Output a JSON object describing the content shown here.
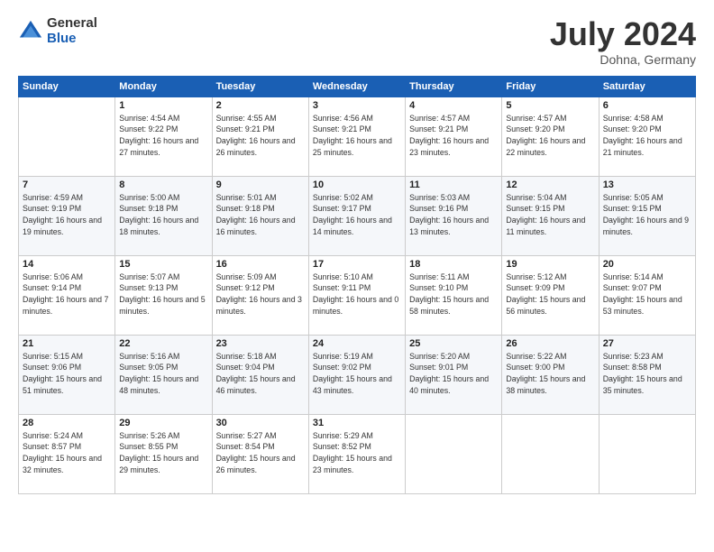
{
  "header": {
    "logo_general": "General",
    "logo_blue": "Blue",
    "month_title": "July 2024",
    "subtitle": "Dohna, Germany"
  },
  "calendar": {
    "days_of_week": [
      "Sunday",
      "Monday",
      "Tuesday",
      "Wednesday",
      "Thursday",
      "Friday",
      "Saturday"
    ],
    "weeks": [
      [
        {
          "day": "",
          "sunrise": "",
          "sunset": "",
          "daylight": ""
        },
        {
          "day": "1",
          "sunrise": "Sunrise: 4:54 AM",
          "sunset": "Sunset: 9:22 PM",
          "daylight": "Daylight: 16 hours and 27 minutes."
        },
        {
          "day": "2",
          "sunrise": "Sunrise: 4:55 AM",
          "sunset": "Sunset: 9:21 PM",
          "daylight": "Daylight: 16 hours and 26 minutes."
        },
        {
          "day": "3",
          "sunrise": "Sunrise: 4:56 AM",
          "sunset": "Sunset: 9:21 PM",
          "daylight": "Daylight: 16 hours and 25 minutes."
        },
        {
          "day": "4",
          "sunrise": "Sunrise: 4:57 AM",
          "sunset": "Sunset: 9:21 PM",
          "daylight": "Daylight: 16 hours and 23 minutes."
        },
        {
          "day": "5",
          "sunrise": "Sunrise: 4:57 AM",
          "sunset": "Sunset: 9:20 PM",
          "daylight": "Daylight: 16 hours and 22 minutes."
        },
        {
          "day": "6",
          "sunrise": "Sunrise: 4:58 AM",
          "sunset": "Sunset: 9:20 PM",
          "daylight": "Daylight: 16 hours and 21 minutes."
        }
      ],
      [
        {
          "day": "7",
          "sunrise": "Sunrise: 4:59 AM",
          "sunset": "Sunset: 9:19 PM",
          "daylight": "Daylight: 16 hours and 19 minutes."
        },
        {
          "day": "8",
          "sunrise": "Sunrise: 5:00 AM",
          "sunset": "Sunset: 9:18 PM",
          "daylight": "Daylight: 16 hours and 18 minutes."
        },
        {
          "day": "9",
          "sunrise": "Sunrise: 5:01 AM",
          "sunset": "Sunset: 9:18 PM",
          "daylight": "Daylight: 16 hours and 16 minutes."
        },
        {
          "day": "10",
          "sunrise": "Sunrise: 5:02 AM",
          "sunset": "Sunset: 9:17 PM",
          "daylight": "Daylight: 16 hours and 14 minutes."
        },
        {
          "day": "11",
          "sunrise": "Sunrise: 5:03 AM",
          "sunset": "Sunset: 9:16 PM",
          "daylight": "Daylight: 16 hours and 13 minutes."
        },
        {
          "day": "12",
          "sunrise": "Sunrise: 5:04 AM",
          "sunset": "Sunset: 9:15 PM",
          "daylight": "Daylight: 16 hours and 11 minutes."
        },
        {
          "day": "13",
          "sunrise": "Sunrise: 5:05 AM",
          "sunset": "Sunset: 9:15 PM",
          "daylight": "Daylight: 16 hours and 9 minutes."
        }
      ],
      [
        {
          "day": "14",
          "sunrise": "Sunrise: 5:06 AM",
          "sunset": "Sunset: 9:14 PM",
          "daylight": "Daylight: 16 hours and 7 minutes."
        },
        {
          "day": "15",
          "sunrise": "Sunrise: 5:07 AM",
          "sunset": "Sunset: 9:13 PM",
          "daylight": "Daylight: 16 hours and 5 minutes."
        },
        {
          "day": "16",
          "sunrise": "Sunrise: 5:09 AM",
          "sunset": "Sunset: 9:12 PM",
          "daylight": "Daylight: 16 hours and 3 minutes."
        },
        {
          "day": "17",
          "sunrise": "Sunrise: 5:10 AM",
          "sunset": "Sunset: 9:11 PM",
          "daylight": "Daylight: 16 hours and 0 minutes."
        },
        {
          "day": "18",
          "sunrise": "Sunrise: 5:11 AM",
          "sunset": "Sunset: 9:10 PM",
          "daylight": "Daylight: 15 hours and 58 minutes."
        },
        {
          "day": "19",
          "sunrise": "Sunrise: 5:12 AM",
          "sunset": "Sunset: 9:09 PM",
          "daylight": "Daylight: 15 hours and 56 minutes."
        },
        {
          "day": "20",
          "sunrise": "Sunrise: 5:14 AM",
          "sunset": "Sunset: 9:07 PM",
          "daylight": "Daylight: 15 hours and 53 minutes."
        }
      ],
      [
        {
          "day": "21",
          "sunrise": "Sunrise: 5:15 AM",
          "sunset": "Sunset: 9:06 PM",
          "daylight": "Daylight: 15 hours and 51 minutes."
        },
        {
          "day": "22",
          "sunrise": "Sunrise: 5:16 AM",
          "sunset": "Sunset: 9:05 PM",
          "daylight": "Daylight: 15 hours and 48 minutes."
        },
        {
          "day": "23",
          "sunrise": "Sunrise: 5:18 AM",
          "sunset": "Sunset: 9:04 PM",
          "daylight": "Daylight: 15 hours and 46 minutes."
        },
        {
          "day": "24",
          "sunrise": "Sunrise: 5:19 AM",
          "sunset": "Sunset: 9:02 PM",
          "daylight": "Daylight: 15 hours and 43 minutes."
        },
        {
          "day": "25",
          "sunrise": "Sunrise: 5:20 AM",
          "sunset": "Sunset: 9:01 PM",
          "daylight": "Daylight: 15 hours and 40 minutes."
        },
        {
          "day": "26",
          "sunrise": "Sunrise: 5:22 AM",
          "sunset": "Sunset: 9:00 PM",
          "daylight": "Daylight: 15 hours and 38 minutes."
        },
        {
          "day": "27",
          "sunrise": "Sunrise: 5:23 AM",
          "sunset": "Sunset: 8:58 PM",
          "daylight": "Daylight: 15 hours and 35 minutes."
        }
      ],
      [
        {
          "day": "28",
          "sunrise": "Sunrise: 5:24 AM",
          "sunset": "Sunset: 8:57 PM",
          "daylight": "Daylight: 15 hours and 32 minutes."
        },
        {
          "day": "29",
          "sunrise": "Sunrise: 5:26 AM",
          "sunset": "Sunset: 8:55 PM",
          "daylight": "Daylight: 15 hours and 29 minutes."
        },
        {
          "day": "30",
          "sunrise": "Sunrise: 5:27 AM",
          "sunset": "Sunset: 8:54 PM",
          "daylight": "Daylight: 15 hours and 26 minutes."
        },
        {
          "day": "31",
          "sunrise": "Sunrise: 5:29 AM",
          "sunset": "Sunset: 8:52 PM",
          "daylight": "Daylight: 15 hours and 23 minutes."
        },
        {
          "day": "",
          "sunrise": "",
          "sunset": "",
          "daylight": ""
        },
        {
          "day": "",
          "sunrise": "",
          "sunset": "",
          "daylight": ""
        },
        {
          "day": "",
          "sunrise": "",
          "sunset": "",
          "daylight": ""
        }
      ]
    ]
  }
}
